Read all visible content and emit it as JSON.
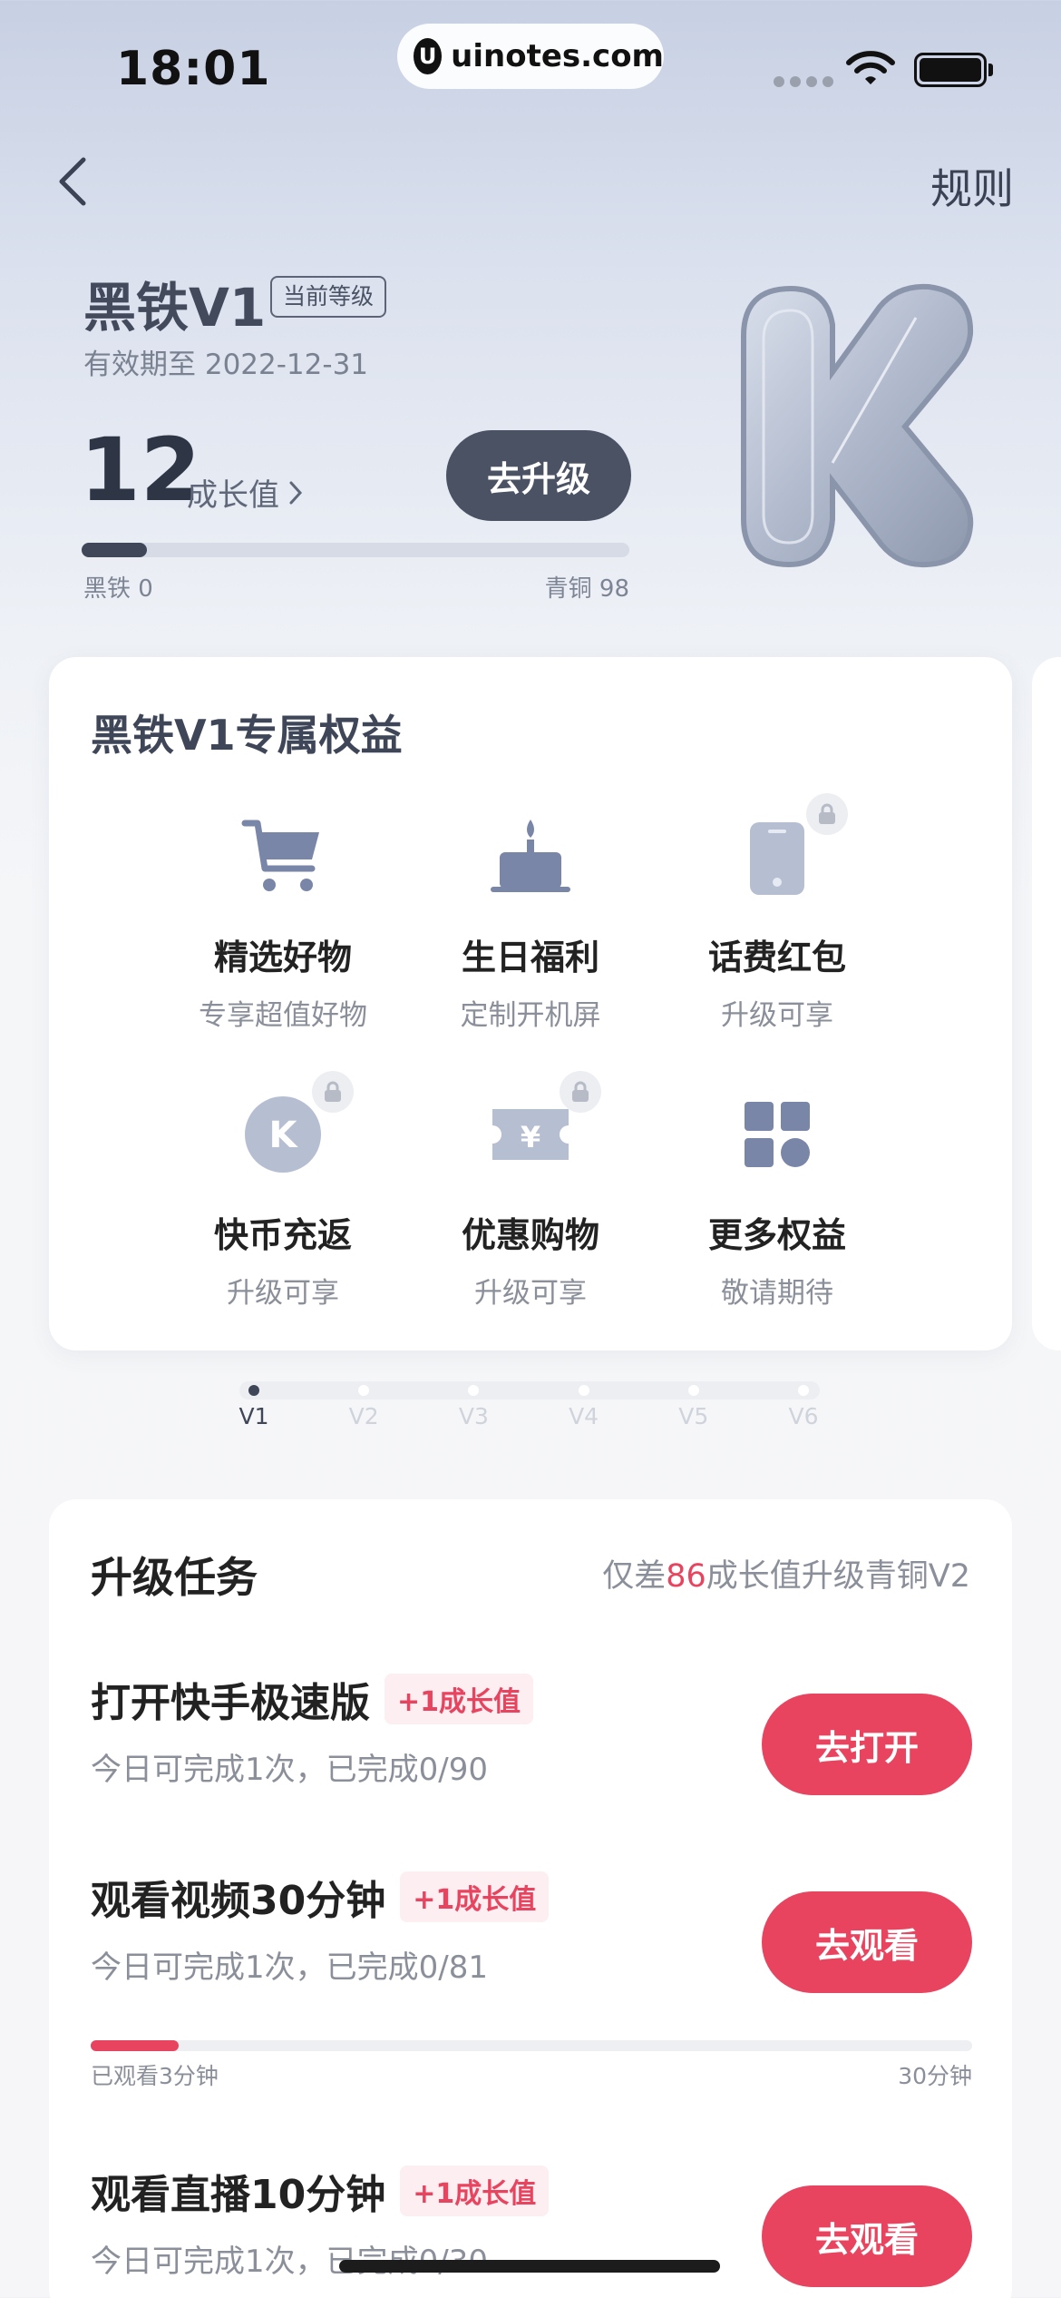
{
  "status_bar": {
    "time": "18:01",
    "url": "uinotes.com",
    "logo_letter": "U"
  },
  "nav": {
    "back_icon": "chevron-left-icon",
    "rules_label": "规则"
  },
  "level": {
    "name": "黑铁V1",
    "badge": "当前等级",
    "validity": "有效期至 2022-12-31",
    "growth_value": "12",
    "growth_label": "成长值",
    "upgrade_button": "去升级",
    "progress": 0.12,
    "range_min": "黑铁 0",
    "range_max": "青铜 98",
    "emblem_letter": "K"
  },
  "benefits": {
    "title": "黑铁V1专属权益",
    "items": [
      {
        "name": "精选好物",
        "desc": "专享超值好物",
        "icon": "shopping-cart-icon",
        "locked": false
      },
      {
        "name": "生日福利",
        "desc": "定制开机屏",
        "icon": "birthday-cake-icon",
        "locked": false
      },
      {
        "name": "话费红包",
        "desc": "升级可享",
        "icon": "phone-icon",
        "locked": true
      },
      {
        "name": "快币充返",
        "desc": "升级可享",
        "icon": "kuaibi-coin-icon",
        "coin_letter": "K",
        "locked": true
      },
      {
        "name": "优惠购物",
        "desc": "升级可享",
        "icon": "coupon-icon",
        "coupon_symbol": "¥",
        "locked": true
      },
      {
        "name": "更多权益",
        "desc": "敬请期待",
        "icon": "more-grid-icon",
        "locked": false
      }
    ]
  },
  "pager": {
    "levels": [
      "V1",
      "V2",
      "V3",
      "V4",
      "V5",
      "V6"
    ],
    "active_index": 0
  },
  "tasks": {
    "title": "升级任务",
    "summary_prefix": "仅差",
    "summary_highlight": "86",
    "summary_suffix": "成长值升级青铜V2",
    "items": [
      {
        "title": "打开快手极速版",
        "reward": "+1成长值",
        "subtitle": "今日可完成1次，已完成0/90",
        "button": "去打开"
      },
      {
        "title": "观看视频30分钟",
        "reward": "+1成长值",
        "subtitle": "今日可完成1次，已完成0/81",
        "button": "去观看",
        "progress": 0.1,
        "progress_left": "已观看3分钟",
        "progress_right": "30分钟"
      },
      {
        "title": "观看直播10分钟",
        "reward": "+1成长值",
        "subtitle": "今日可完成1次，已完成0/30",
        "button": "去观看"
      }
    ]
  },
  "colors": {
    "accent": "#e8445f",
    "dark": "#4a5263",
    "icon_active": "#7a86a8",
    "icon_locked": "#b6bfd2"
  }
}
